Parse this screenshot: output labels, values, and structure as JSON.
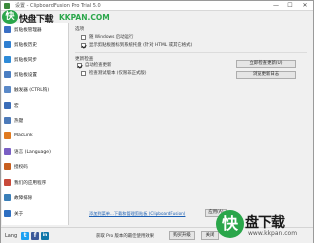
{
  "window": {
    "title": "设置 - ClipboardFusion Pro Trial 5.0",
    "min_glyph": "—",
    "max_glyph": "☐",
    "close_glyph": "✕"
  },
  "watermark": {
    "logo_char": "快",
    "cn_text": "快盘下载",
    "domain": "KKPAN.COM",
    "br_logo_char": "快",
    "br_cn_text": "盘下载",
    "br_domain": "www.kkpan.com"
  },
  "sidebar": {
    "items": [
      {
        "label": "剪贴板管理器",
        "icon": "clipboard-icon",
        "color": "#3a6fc4"
      },
      {
        "label": "剪贴板历史",
        "icon": "history-icon",
        "color": "#2f7fd1"
      },
      {
        "label": "剪贴板同步",
        "icon": "sync-icon",
        "color": "#2e8bd8"
      },
      {
        "label": "剪贴板设置",
        "icon": "settings-icon",
        "color": "#4a7ec2"
      },
      {
        "label": "触发器 (CTRL钩)",
        "icon": "trigger-icon",
        "color": "#5a89c8"
      },
      {
        "label": "宏",
        "icon": "macro-icon",
        "color": "#3b6db8"
      },
      {
        "label": "热键",
        "icon": "hotkey-icon",
        "color": "#4c7ab9"
      },
      {
        "label": "MacLink",
        "icon": "link-icon",
        "color": "#e07a1f"
      },
      {
        "label": "语言 (Language)",
        "icon": "language-icon",
        "color": "#7a5fc4"
      },
      {
        "label": "授权码",
        "icon": "license-icon",
        "color": "#c75f1f"
      },
      {
        "label": "我们的应用程序",
        "icon": "apps-icon",
        "color": "#c84a3a"
      },
      {
        "label": "故障排除",
        "icon": "troubleshoot-icon",
        "color": "#3a7fb8"
      },
      {
        "label": "关于",
        "icon": "info-icon",
        "color": "#2e6fc2"
      }
    ]
  },
  "settings": {
    "group1_title": "选项",
    "option1": {
      "label": "随 Windows 启动运行",
      "checked": false
    },
    "option2": {
      "label": "显示剪贴板图标到系统托盘 (针对 HTML 或其它格式)",
      "checked": true
    },
    "group2_title": "更新检查",
    "auto_check": {
      "label": "自动检查更新",
      "checked": true
    },
    "beta_check": {
      "label": "检查测试版本 (仅限非正式版)",
      "checked": false
    },
    "check_now_button": "立即检查更新(U)",
    "view_changelog_button": "浏览更新日志",
    "reset_link": "添加到菜单...下载和管理剪贴板 (ClipboardFusion)",
    "apply_button": "应用(A)"
  },
  "footer": {
    "lang_label": "Lang",
    "social": [
      {
        "icon": "twitter-icon",
        "glyph": "t",
        "color": "#1da1f2"
      },
      {
        "icon": "facebook-icon",
        "glyph": "f",
        "color": "#3b5998"
      },
      {
        "icon": "linkedin-icon",
        "glyph": "in",
        "color": "#0e76a8"
      }
    ],
    "promo_text": "获取 Pro 版本的最佳使用效果",
    "buy_button": "购买升级",
    "close_button": "关闭"
  }
}
